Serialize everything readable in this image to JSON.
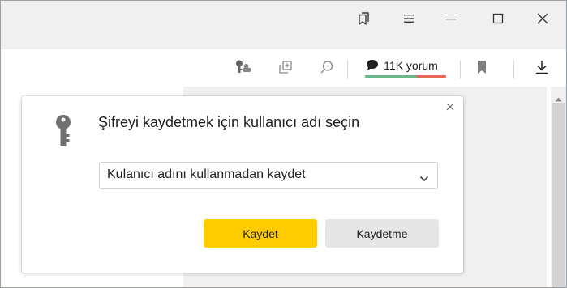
{
  "window": {
    "controls": {
      "collections_icon": "bookmarks-stack-icon",
      "menu_icon": "menu-icon",
      "minimize_icon": "minimize-icon",
      "maximize_icon": "maximize-icon",
      "close_icon": "close-icon"
    }
  },
  "toolbar": {
    "comments": {
      "label": "11K yorum",
      "positive_color": "#6bb58a",
      "negative_color": "#e5675a",
      "positive_share": 0.64
    }
  },
  "password_popup": {
    "title": "Şifreyi kaydetmek için kullanıcı adı seçin",
    "username_select": {
      "selected": "Kulanıcı adını kullanmadan kaydet"
    },
    "save_button": "Kaydet",
    "dont_save_button": "Kaydetme",
    "accent_color": "#ffcc00"
  }
}
